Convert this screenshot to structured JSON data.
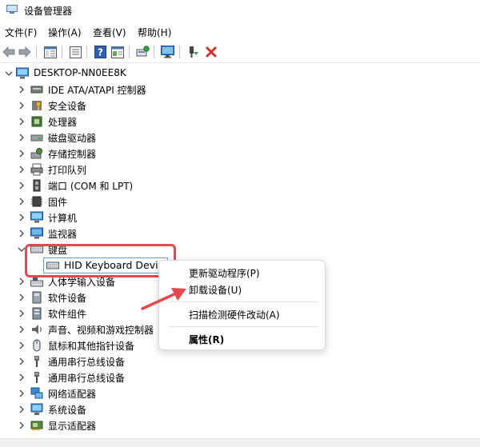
{
  "window": {
    "title": "设备管理器"
  },
  "menu": {
    "file": "文件(F)",
    "action": "操作(A)",
    "view": "查看(V)",
    "help": "帮助(H)"
  },
  "toolbar": {
    "icons": [
      "back-arrow-icon",
      "forward-arrow-icon",
      "properties-sheet-icon",
      "console-icon",
      "help-icon",
      "view-icon",
      "scan-hardware-icon",
      "monitor-icon",
      "enable-device-icon",
      "uninstall-x-icon"
    ],
    "uninstall_color": "#d32f2f"
  },
  "tree": {
    "root": "DESKTOP-NN0EE8K",
    "nodes": [
      {
        "label": "IDE ATA/ATAPI 控制器",
        "icon": "ide-controller-icon"
      },
      {
        "label": "安全设备",
        "icon": "security-key-icon"
      },
      {
        "label": "处理器",
        "icon": "processor-icon"
      },
      {
        "label": "磁盘驱动器",
        "icon": "disk-drive-icon"
      },
      {
        "label": "存储控制器",
        "icon": "storage-controller-icon"
      },
      {
        "label": "打印队列",
        "icon": "printer-icon"
      },
      {
        "label": "端口 (COM 和 LPT)",
        "icon": "port-icon"
      },
      {
        "label": "固件",
        "icon": "firmware-icon"
      },
      {
        "label": "计算机",
        "icon": "computer-icon"
      },
      {
        "label": "监视器",
        "icon": "monitor-icon"
      },
      {
        "label": "键盘",
        "icon": "keyboard-icon",
        "expanded": true
      },
      {
        "label": "HID Keyboard Devic",
        "icon": "keyboard-icon",
        "child": true
      },
      {
        "label": "人体学输入设备",
        "icon": "hid-icon"
      },
      {
        "label": "软件设备",
        "icon": "software-device-icon"
      },
      {
        "label": "软件组件",
        "icon": "software-component-icon"
      },
      {
        "label": "声音、视频和游戏控制器",
        "icon": "speaker-icon"
      },
      {
        "label": "鼠标和其他指针设备",
        "icon": "mouse-icon"
      },
      {
        "label": "通用串行总线设备",
        "icon": "usb-icon"
      },
      {
        "label": "通用串行总线设备",
        "icon": "usb-icon"
      },
      {
        "label": "网络适配器",
        "icon": "network-adapter-icon"
      },
      {
        "label": "系统设备",
        "icon": "system-device-icon"
      },
      {
        "label": "显示适配器",
        "icon": "display-adapter-icon"
      }
    ]
  },
  "context_menu": {
    "update_driver": "更新驱动程序(P)",
    "uninstall": "卸载设备(U)",
    "scan": "扫描检测硬件改动(A)",
    "properties": "属性(R)"
  },
  "colors": {
    "highlight_box": "#e5484d",
    "selection_border": "#6b9bd1"
  }
}
